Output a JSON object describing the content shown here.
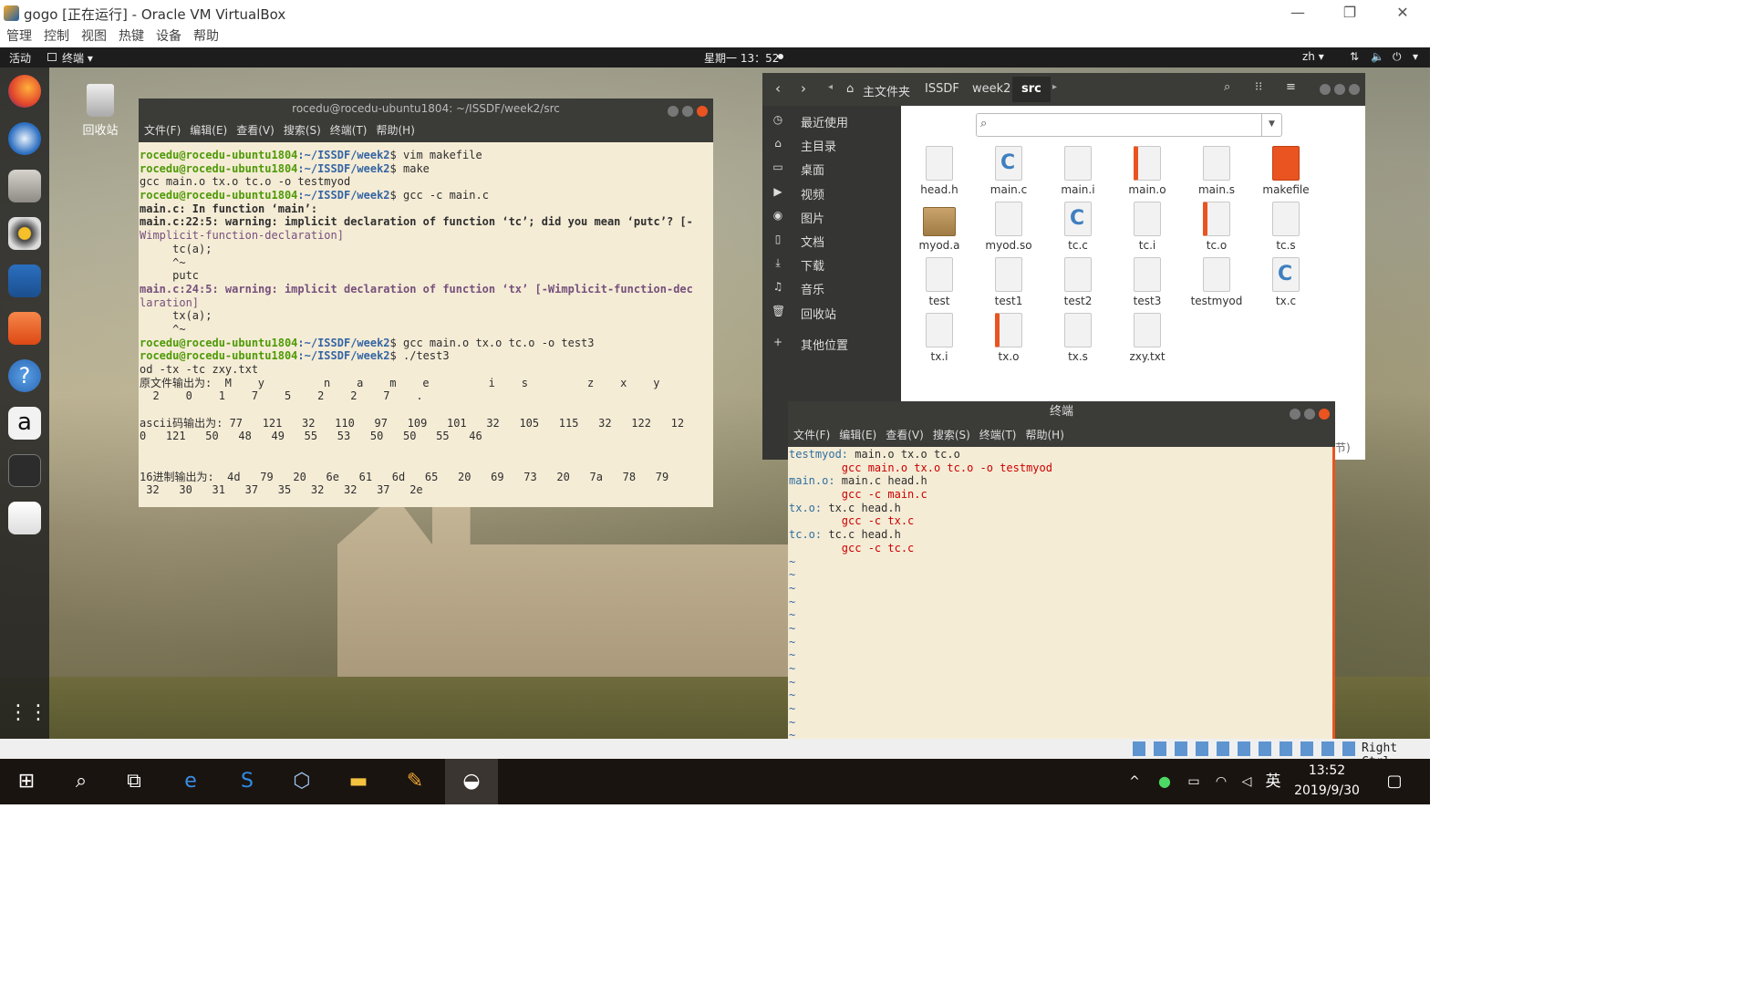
{
  "host": {
    "window_title": "gogo [正在运行] - Oracle VM VirtualBox",
    "menu": [
      "管理",
      "控制",
      "视图",
      "热键",
      "设备",
      "帮助"
    ],
    "controls": {
      "minimize": "—",
      "restore": "❐",
      "close": "✕"
    }
  },
  "ubuntu": {
    "activities": "活动",
    "app_menu": "终端 ▾",
    "clock": "星期一 13：52",
    "lang": "zh ▾",
    "trash_label": "回收站"
  },
  "terminal1": {
    "title": "rocedu@rocedu-ubuntu1804: ~/ISSDF/week2/src",
    "menu": [
      "文件(F)",
      "编辑(E)",
      "查看(V)",
      "搜索(S)",
      "终端(T)",
      "帮助(H)"
    ],
    "lines": [
      {
        "a": "rocedu@rocedu-ubuntu1804",
        "b": ":~/ISSDF/week2",
        "c": "$ vim makefile"
      },
      {
        "a": "rocedu@rocedu-ubuntu1804",
        "b": ":~/ISSDF/week2",
        "c": "$ make"
      },
      {
        "t": "gcc main.o tx.o tc.o -o testmyod"
      },
      {
        "a": "rocedu@rocedu-ubuntu1804",
        "b": ":~/ISSDF/week2",
        "c": "$ gcc -c main.c"
      },
      {
        "t": "main.c: In function ‘main’:"
      },
      {
        "t": "main.c:22:5: warning: implicit declaration of function ‘tc’; did you mean ‘putc’? [-"
      },
      {
        "t": "Wimplicit-function-declaration]"
      },
      {
        "t": "     tc(a);"
      },
      {
        "t": "     ^~"
      },
      {
        "t": "     putc"
      },
      {
        "t": "main.c:24:5: warning: implicit declaration of function ‘tx’ [-Wimplicit-function-dec"
      },
      {
        "t": "laration]"
      },
      {
        "t": "     tx(a);"
      },
      {
        "t": "     ^~"
      },
      {
        "a": "rocedu@rocedu-ubuntu1804",
        "b": ":~/ISSDF/week2",
        "c": "$ gcc main.o tx.o tc.o -o test3"
      },
      {
        "a": "rocedu@rocedu-ubuntu1804",
        "b": ":~/ISSDF/week2",
        "c": "$ ./test3"
      },
      {
        "t": "od -tx -tc zxy.txt"
      },
      {
        "t": "原文件输出为:  M    y         n    a    m    e         i    s         z    x    y"
      },
      {
        "t": "  2    0    1    7    5    2    2    7    ."
      },
      {
        "t": ""
      },
      {
        "t": "ascii码输出为: 77   121   32   110   97   109   101   32   105   115   32   122   12"
      },
      {
        "t": "0   121   50   48   49   55   53   50   50   55   46"
      },
      {
        "t": ""
      },
      {
        "t": ""
      },
      {
        "t": "16进制输出为:  4d   79   20   6e   61   6d   65   20   69   73   20   7a   78   79"
      },
      {
        "t": " 32   30   31   37   35   32   32   37   2e"
      }
    ]
  },
  "files": {
    "breadcrumb": [
      "主文件夹",
      "ISSDF",
      "week2",
      "src"
    ],
    "sidebar": [
      "最近使用",
      "主目录",
      "桌面",
      "视频",
      "图片",
      "文档",
      "下载",
      "音乐",
      "回收站",
      "其他位置"
    ],
    "sidebar_icons": [
      "clock-icon",
      "home-icon",
      "desktop-icon",
      "video-icon",
      "camera-icon",
      "document-icon",
      "download-icon",
      "music-icon",
      "trash-icon",
      "plus-icon"
    ],
    "sidebar_glyphs": [
      "◷",
      "⌂",
      "▭",
      "▶",
      "◉",
      "▯",
      "⤓",
      "♫",
      "🗑",
      "+"
    ],
    "items": [
      {
        "name": "head.h",
        "kind": "txt"
      },
      {
        "name": "main.c",
        "kind": "c"
      },
      {
        "name": "main.i",
        "kind": "txt"
      },
      {
        "name": "main.o",
        "kind": "o"
      },
      {
        "name": "main.s",
        "kind": "txt"
      },
      {
        "name": "makefile",
        "kind": "mk"
      },
      {
        "name": "myod.a",
        "kind": "box"
      },
      {
        "name": "myod.so",
        "kind": "txt"
      },
      {
        "name": "tc.c",
        "kind": "c"
      },
      {
        "name": "tc.i",
        "kind": "txt"
      },
      {
        "name": "tc.o",
        "kind": "o"
      },
      {
        "name": "tc.s",
        "kind": "txt"
      },
      {
        "name": "test",
        "kind": "txt"
      },
      {
        "name": "test1",
        "kind": "txt"
      },
      {
        "name": "test2",
        "kind": "txt"
      },
      {
        "name": "test3",
        "kind": "txt"
      },
      {
        "name": "testmyod",
        "kind": "txt"
      },
      {
        "name": "tx.c",
        "kind": "c"
      },
      {
        "name": "tx.i",
        "kind": "txt"
      },
      {
        "name": "tx.o",
        "kind": "o"
      },
      {
        "name": "tx.s",
        "kind": "txt"
      },
      {
        "name": "zxy.txt",
        "kind": "txt"
      }
    ],
    "status_fragment": "节)"
  },
  "terminal2": {
    "title": "终端",
    "menu": [
      "文件(F)",
      "编辑(E)",
      "查看(V)",
      "搜索(S)",
      "终端(T)",
      "帮助(H)"
    ],
    "makefile": [
      {
        "k": "testmyod:",
        "v": " main.o tx.o tc.o"
      },
      {
        "cmd": "        gcc main.o tx.o tc.o -o testmyod"
      },
      {
        "k": "main.o:",
        "v": " main.c head.h"
      },
      {
        "cmd": "        gcc -c main.c"
      },
      {
        "k": "tx.o:",
        "v": " tx.c head.h"
      },
      {
        "cmd": "        gcc -c tx.c"
      },
      {
        "k": "tc.o:",
        "v": " tc.c head.h"
      },
      {
        "cmd": "        gcc -c tc.c"
      }
    ],
    "tilde_count": 14
  },
  "vbox_status": {
    "right_ctrl": "Right Ctrl"
  },
  "taskbar": {
    "time": "13:52",
    "date": "2019/9/30",
    "ime": "英"
  },
  "colors": {
    "ubuntu_orange": "#e95420",
    "terminal_bg": "#f5ecd6",
    "prompt_green": "#4e9a06",
    "path_blue": "#3465a4",
    "warning_purple": "#75507b"
  }
}
